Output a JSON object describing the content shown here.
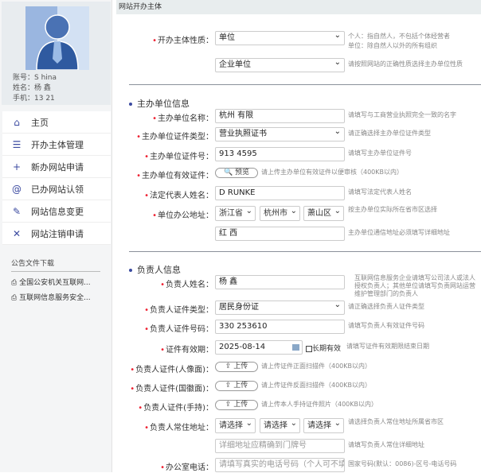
{
  "profile": {
    "account": "账号：S        hina",
    "name": "姓名：杨  鑫",
    "phone": "手机：13         21"
  },
  "menu": [
    {
      "icon": "⌂",
      "label": "主页"
    },
    {
      "icon": "☰",
      "label": "开办主体管理"
    },
    {
      "icon": "+",
      "label": "新办网站申请"
    },
    {
      "icon": "@",
      "label": "已办网站认领"
    },
    {
      "icon": "✎",
      "label": "网站信息变更"
    },
    {
      "icon": "✕",
      "label": "网站注销申请"
    }
  ],
  "notice": {
    "title": "公告文件下载",
    "files": [
      "全国公安机关互联网...",
      "互联网信息服务安全..."
    ]
  },
  "header": "网站开办主体",
  "subject": {
    "label": "开办主体性质：",
    "value": "单位",
    "hint1": "个人：指自然人，不包括个体经营者",
    "hint2": "单位：除自然人以外的所有组织",
    "value2": "企业单位",
    "hint3": "请按照网站的正确性质选择主办单位性质"
  },
  "org": {
    "title": "主办单位信息",
    "name": {
      "label": "主办单位名称：",
      "value": "杭州          有限",
      "hint": "请填写与工商营业执照完全一致的名字"
    },
    "cert_type": {
      "label": "主办单位证件类型：",
      "value": "营业执照证书",
      "hint": "请正确选择主办单位证件类型"
    },
    "cert_no": {
      "label": "主办单位证件号：",
      "value": "913           4595",
      "hint": "请填写主办单位证件号"
    },
    "cert_file": {
      "label": "主办单位有效证件：",
      "button": "🔍 预览",
      "hint": "请上传主办单位有效证件以便审核（400KB以内）"
    },
    "legal": {
      "label": "法定代表人姓名：",
      "value": "D          RUNKE",
      "hint": "请填写法定代表人姓名"
    },
    "address": {
      "label": "单位办公地址：",
      "province": "浙江省",
      "city": "杭州市",
      "district": "萧山区",
      "hint": "按主办单位实际所在省市区选择",
      "detail": "红          西",
      "detail_hint": "主办单位通信地址必须填写详细地址"
    }
  },
  "person": {
    "title": "负责人信息",
    "name": {
      "label": "负责人姓名：",
      "value": "杨  鑫",
      "hint": "互联网信息服务企业请填写公司法人或法人授权负责人；其他单位请填写负责网站运营维护管理部门的负责人"
    },
    "id_type": {
      "label": "负责人证件类型：",
      "value": "居民身份证",
      "hint": "请正确选择负责人证件类型"
    },
    "id_no": {
      "label": "负责人证件号码：",
      "value": "330         253610",
      "hint": "请填写负责人有效证件号码"
    },
    "expiry": {
      "label": "证件有效期：",
      "value": "2025-08-14",
      "long_term": "长期有效",
      "hint": "请填写证件有效期限结束日期"
    },
    "front": {
      "label": "负责人证件(人像面)：",
      "button": "⇪ 上传",
      "hint": "请上传证件正面扫描件（400KB以内）"
    },
    "back": {
      "label": "负责人证件(国徽面)：",
      "button": "⇪ 上传",
      "hint": "请上传证件反面扫描件（400KB以内）"
    },
    "hold": {
      "label": "负责人证件(手持)：",
      "button": "⇪ 上传",
      "hint": "请上传本人手持证件照片（400KB以内）"
    },
    "address": {
      "label": "负责人常住地址：",
      "p": "请选择",
      "c": "请选择",
      "d": "请选择",
      "hint": "请选择负责人常住地址所属省市区",
      "detail_ph": "详细地址应精确到门牌号",
      "detail_hint": "请填写负责人常住详细地址"
    },
    "phone": {
      "label": "办公室电话：",
      "ph": "请填写真实的电话号码（个人可不填）",
      "hint": "国家号码(默认：0086)-区号-电话号码"
    }
  }
}
